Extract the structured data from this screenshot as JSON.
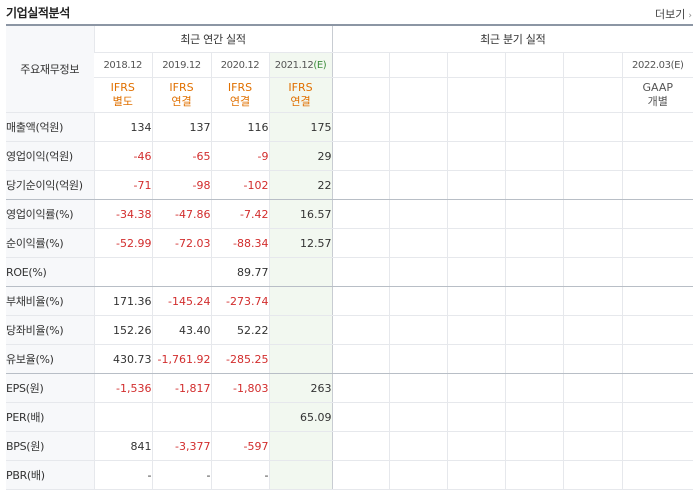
{
  "header": {
    "title": "기업실적분석",
    "more_label": "더보기",
    "more_arrow": "›"
  },
  "table": {
    "corner_label": "주요재무정보",
    "annual_group": "최근 연간 실적",
    "quarter_group": "최근 분기 실적",
    "annual_periods": [
      {
        "label": "2018.12",
        "est": ""
      },
      {
        "label": "2019.12",
        "est": ""
      },
      {
        "label": "2020.12",
        "est": ""
      },
      {
        "label": "2021.12",
        "est": "(E)"
      }
    ],
    "quarter_last_period": "2022.03(E)",
    "annual_standards": [
      {
        "l1": "IFRS",
        "l2": "별도"
      },
      {
        "l1": "IFRS",
        "l2": "연결"
      },
      {
        "l1": "IFRS",
        "l2": "연결"
      },
      {
        "l1": "IFRS",
        "l2": "연결"
      }
    ],
    "quarter_last_standard": {
      "l1": "GAAP",
      "l2": "개별"
    },
    "rows": [
      {
        "label": "매출액(억원)",
        "values": [
          "134",
          "137",
          "116",
          "175"
        ],
        "sep": false
      },
      {
        "label": "영업이익(억원)",
        "values": [
          "-46",
          "-65",
          "-9",
          "29"
        ],
        "sep": false
      },
      {
        "label": "당기순이익(억원)",
        "values": [
          "-71",
          "-98",
          "-102",
          "22"
        ],
        "sep": true
      },
      {
        "label": "영업이익률(%)",
        "values": [
          "-34.38",
          "-47.86",
          "-7.42",
          "16.57"
        ],
        "sep": false
      },
      {
        "label": "순이익률(%)",
        "values": [
          "-52.99",
          "-72.03",
          "-88.34",
          "12.57"
        ],
        "sep": false
      },
      {
        "label": "ROE(%)",
        "values": [
          "",
          "",
          "89.77",
          ""
        ],
        "sep": true
      },
      {
        "label": "부채비율(%)",
        "values": [
          "171.36",
          "-145.24",
          "-273.74",
          ""
        ],
        "sep": false
      },
      {
        "label": "당좌비율(%)",
        "values": [
          "152.26",
          "43.40",
          "52.22",
          ""
        ],
        "sep": false
      },
      {
        "label": "유보율(%)",
        "values": [
          "430.73",
          "-1,761.92",
          "-285.25",
          ""
        ],
        "sep": true
      },
      {
        "label": "EPS(원)",
        "values": [
          "-1,536",
          "-1,817",
          "-1,803",
          "263"
        ],
        "sep": false
      },
      {
        "label": "PER(배)",
        "values": [
          "",
          "",
          "",
          "65.09"
        ],
        "sep": false
      },
      {
        "label": "BPS(원)",
        "values": [
          "841",
          "-3,377",
          "-597",
          ""
        ],
        "sep": false
      },
      {
        "label": "PBR(배)",
        "values": [
          "-",
          "-",
          "-",
          ""
        ],
        "sep": false
      }
    ]
  }
}
